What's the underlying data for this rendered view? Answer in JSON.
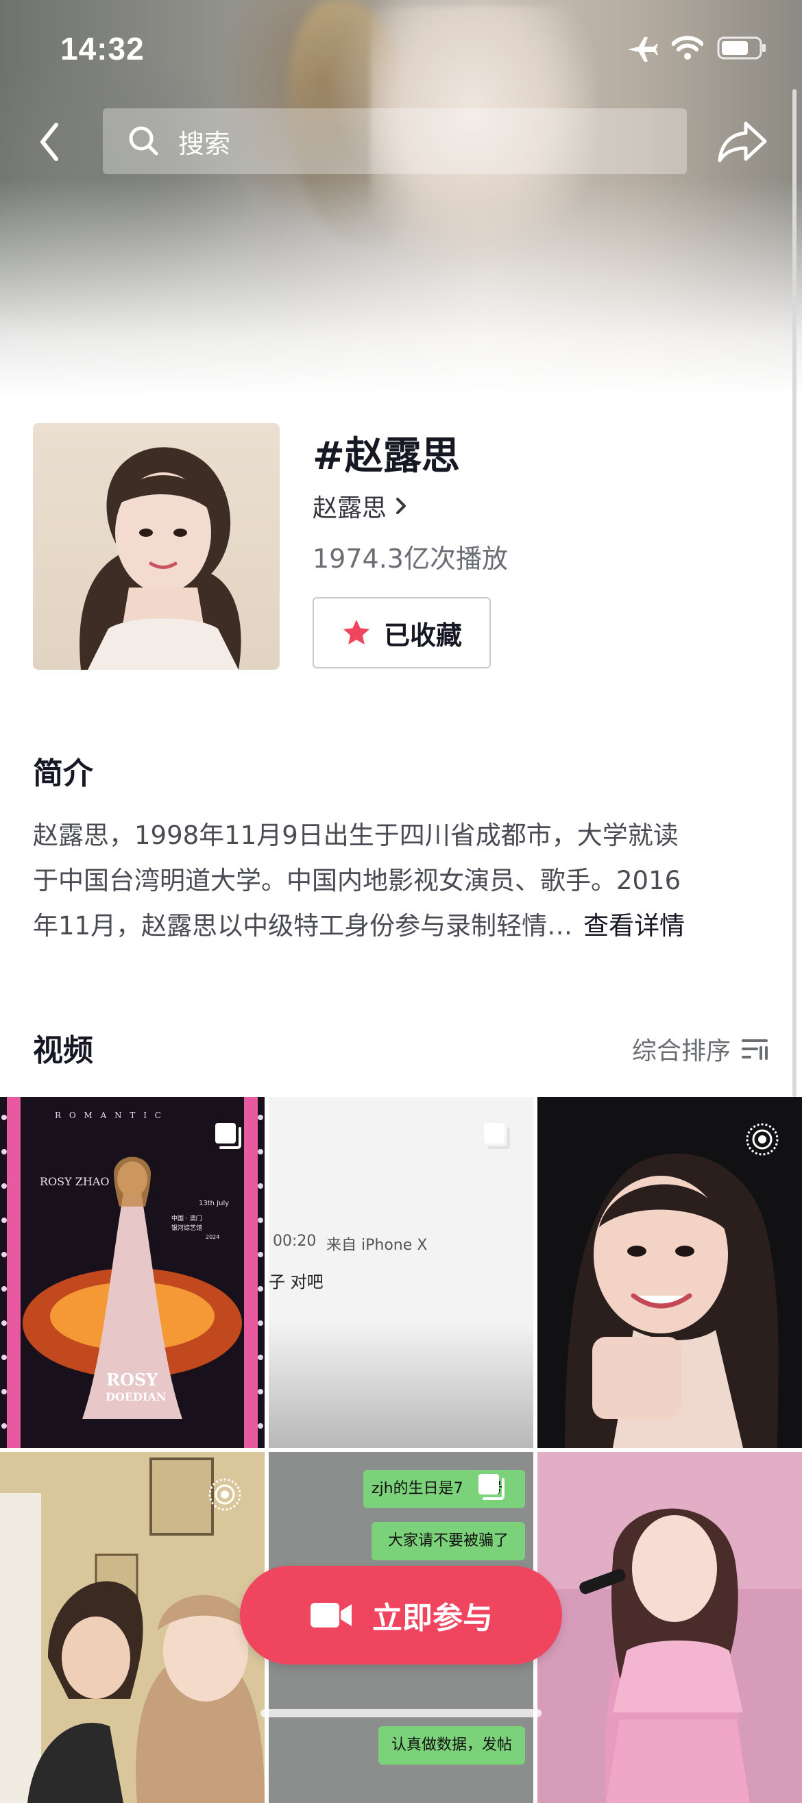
{
  "status_bar": {
    "time": "14:32"
  },
  "header": {
    "search_placeholder": "搜索"
  },
  "topic": {
    "title": "#赵露思",
    "creator": "赵露思",
    "plays": "1974.3亿次播放",
    "favorite_label": "已收藏"
  },
  "intro": {
    "heading": "简介",
    "lines": [
      "赵露思，1998年11月9日出生于四川省成都市，大学就读",
      "于中国台湾明道大学。中国内地影视女演员、歌手。2016",
      "年11月，赵露思以中级特工身份参与录制轻情…"
    ],
    "more_label": "查看详情"
  },
  "videos": {
    "heading": "视频",
    "sort_label": "综合排序",
    "items": [
      {
        "type": "multi",
        "texts": [
          "R O M A N T I C",
          "ROSY ZHAO",
          "中国 · 澳门",
          "银河综艺馆",
          "13th July",
          "2024",
          "ROSY",
          "DOEDIAN"
        ]
      },
      {
        "type": "multi",
        "texts": [
          "00:20",
          "来自 iPhone X",
          "子 对吧"
        ]
      },
      {
        "type": "live",
        "texts": []
      },
      {
        "type": "live",
        "texts": []
      },
      {
        "type": "multi",
        "texts": [
          "zjh的生日是7",
          "号",
          "大家请不要被骗了",
          "认真做数据，发帖"
        ]
      },
      {
        "type": "none",
        "texts": []
      }
    ]
  },
  "cta": {
    "join_label": "立即参与"
  },
  "colors": {
    "accent": "#f0455f",
    "text": "#161823",
    "secondary": "#6b6d74"
  }
}
